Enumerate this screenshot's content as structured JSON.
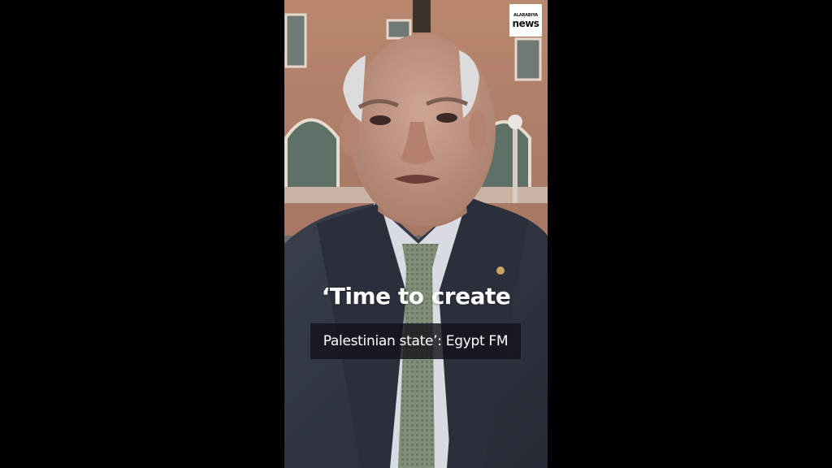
{
  "logo": {
    "top": "ALARABIYA",
    "bottom": "news"
  },
  "caption": {
    "line1": "‘Time to create",
    "line2": "Palestinian state’: Egypt FM"
  },
  "colors": {
    "letterbox": "#000000",
    "caption_box": "#12141c",
    "suit": "#2f3442",
    "tie": "#7f8f78"
  }
}
